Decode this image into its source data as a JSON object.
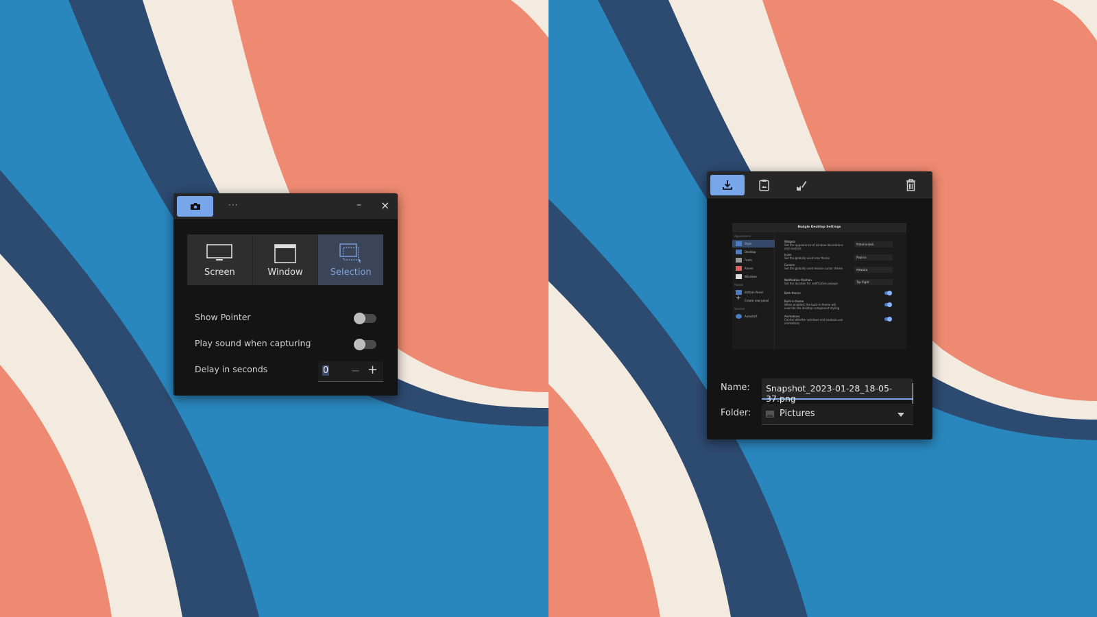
{
  "colors": {
    "blue": "#2a87be",
    "navy": "#2d4a70",
    "cream": "#f3ebe0",
    "salmon": "#ee8a72",
    "accent": "#78a6ea"
  },
  "capture_dialog": {
    "header": {
      "camera_icon": "camera-icon",
      "menu_label": "···",
      "minimize_label": "–",
      "close_label": "×"
    },
    "modes": [
      {
        "label": "Screen",
        "icon": "monitor-icon"
      },
      {
        "label": "Window",
        "icon": "window-icon"
      },
      {
        "label": "Selection",
        "icon": "selection-icon",
        "selected": true
      }
    ],
    "options": {
      "show_pointer": {
        "label": "Show Pointer",
        "on": false
      },
      "play_sound": {
        "label": "Play sound when capturing",
        "on": false
      },
      "delay": {
        "label": "Delay in seconds",
        "value": "0",
        "minus": "−",
        "plus": "+"
      }
    }
  },
  "save_dialog": {
    "toolbar": {
      "save_icon": "download-icon",
      "copy_icon": "clipboard-image-icon",
      "edit_icon": "edit-image-icon",
      "delete_icon": "trash-icon"
    },
    "preview": {
      "title": "Budgie Desktop Settings",
      "sidebar": {
        "appearance": "Appearance",
        "style": "Style",
        "desktop": "Desktop",
        "fonts": "Fonts",
        "raven": "Raven",
        "windows": "Windows",
        "panels": "Panels",
        "bottom_panel": "Bottom Panel",
        "create_panel": "Create new panel",
        "session": "Session",
        "autostart": "Autostart"
      },
      "settings": [
        {
          "title": "Widgets",
          "desc": "Set the appearance of window decorations and controls",
          "value": "Materia-dark"
        },
        {
          "title": "Icons",
          "desc": "Set the globally used icon theme",
          "value": "Papirus"
        },
        {
          "title": "Cursors",
          "desc": "Set the globally used mouse cursor theme",
          "value": "Adwaita"
        },
        {
          "title": "Notification Position",
          "desc": "Set the location for notification popups",
          "value": "Top Right"
        },
        {
          "title": "Dark theme",
          "desc": ""
        },
        {
          "title": "Built-in theme",
          "desc": "When enabled, the built-in theme will override the desktop component styling"
        },
        {
          "title": "Animations",
          "desc": "Control whether windows and controls use animations"
        }
      ]
    },
    "name_label": "Name:",
    "name_value": "Snapshot_2023-01-28_18-05-37.png",
    "folder_label": "Folder:",
    "folder_value": "Pictures"
  }
}
